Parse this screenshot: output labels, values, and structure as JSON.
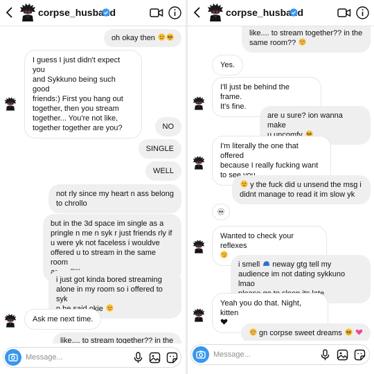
{
  "username": "corpse_husband",
  "composer": {
    "placeholder": "Message..."
  },
  "left_messages": [
    {
      "side": "out",
      "text": "oh okay then",
      "emoji": [
        "neutral",
        "pleading"
      ]
    },
    {
      "side": "in",
      "text": "I guess I just didn't expect you\nand Sykkuno being such good\nfriends:) First you hang out\ntogether, then you stream\ntogether... You're not like,\ntogether together are you?"
    },
    {
      "side": "out",
      "text": "NO"
    },
    {
      "side": "out",
      "text": "SINGLE"
    },
    {
      "side": "out",
      "text": "WELL"
    },
    {
      "side": "out",
      "text": "not rly since my heart n ass belong\nto chrollo"
    },
    {
      "side": "out",
      "text": "but in the 3d space im single as a\npringle n me n syk r just friends rly if\nu were yk not faceless i wouldve\noffered u to stream in the same room\nas well!!!"
    },
    {
      "side": "out",
      "text": "i just got kinda bored streaming\nalone in my room so i offered to syk\nn he said okie",
      "emoji": [
        "sad"
      ]
    },
    {
      "side": "in",
      "text": "Ask me next time."
    },
    {
      "side": "out",
      "text": "like.... to stream together?? in the"
    }
  ],
  "right_messages": [
    {
      "side": "out",
      "text": "like.... to stream together?? in the\nsame room??",
      "emoji": [
        "flushed"
      ]
    },
    {
      "side": "in",
      "text": "Yes."
    },
    {
      "side": "in",
      "text": "I'll just be behind the frame.\nIt's fine."
    },
    {
      "side": "out",
      "text": "are u sure? ion wanna make\nu uncomfy",
      "emoji": [
        "pleading"
      ]
    },
    {
      "side": "in",
      "text": "I'm literally the one that offered\nbecause I really fucking want\nto see you"
    },
    {
      "side": "out",
      "text": "y the fuck did u unsend the msg i\ndidnt manage to read it im slow yk",
      "emoji_before": [
        "neutral"
      ]
    },
    {
      "side": "in",
      "text": "",
      "emoji": [
        "skull"
      ]
    },
    {
      "side": "in",
      "text": "Wanted to check your reflexes\n",
      "emoji": [
        "smirk"
      ]
    },
    {
      "side": "out",
      "text": "i smell",
      "emoji_mid": [
        "cap"
      ],
      "text2": " neway gtg tell my\naudience im not dating sykkuno lmao\nplease go to sleep its late"
    },
    {
      "side": "in",
      "text": "Yeah you do that. Night, kitten\n",
      "emoji": [
        "black-heart"
      ]
    },
    {
      "side": "out",
      "text": " gn corpse sweet dreams ",
      "emoji_before": [
        "flushed"
      ],
      "emoji": [
        "pleading",
        "pink-heart"
      ]
    }
  ],
  "colors": {
    "accent": "#3797f0",
    "verified": "#3897f0",
    "bubble_out": "#efefef"
  },
  "icons": [
    "back-chevron-icon",
    "verified-badge-icon",
    "video-call-icon",
    "info-icon",
    "camera-icon",
    "microphone-icon",
    "gallery-icon",
    "sticker-icon"
  ]
}
